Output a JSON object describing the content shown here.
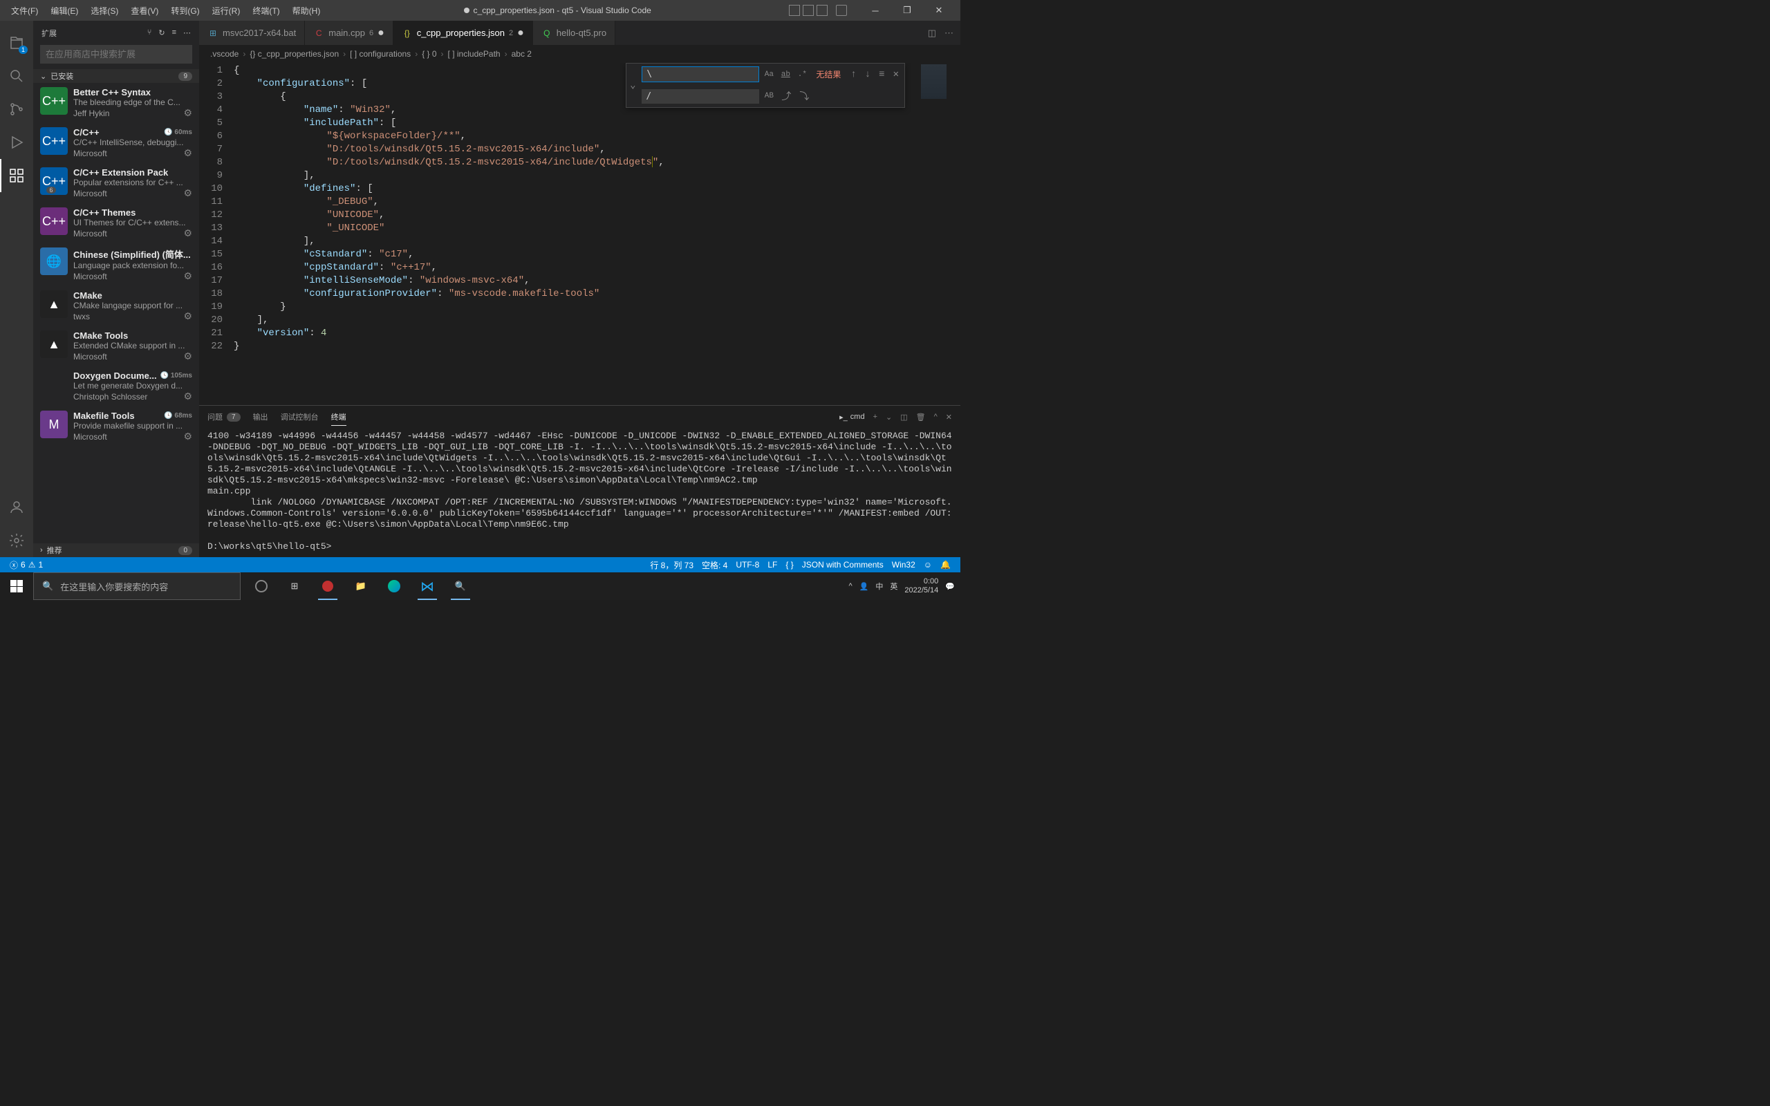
{
  "menubar": [
    "文件(F)",
    "编辑(E)",
    "选择(S)",
    "查看(V)",
    "转到(G)",
    "运行(R)",
    "终端(T)",
    "帮助(H)"
  ],
  "window_title": "c_cpp_properties.json - qt5 - Visual Studio Code",
  "sidebar": {
    "title": "扩展",
    "search_placeholder": "在应用商店中搜索扩展",
    "installed_label": "已安装",
    "installed_count": "9",
    "recommended_label": "推荐",
    "recommended_count": "0"
  },
  "extensions": [
    {
      "name": "Better C++ Syntax",
      "desc": "The bleeding edge of the C...",
      "pub": "Jeff Hykin",
      "color": "#1d7a3a",
      "icon": "C++"
    },
    {
      "name": "C/C++",
      "desc": "C/C++ IntelliSense, debuggi...",
      "pub": "Microsoft",
      "color": "#005ba4",
      "icon": "C++",
      "time": "60ms"
    },
    {
      "name": "C/C++ Extension Pack",
      "desc": "Popular extensions for C++ ...",
      "pub": "Microsoft",
      "color": "#005ba4",
      "icon": "C++",
      "badge": "6"
    },
    {
      "name": "C/C++ Themes",
      "desc": "UI Themes for C/C++ extens...",
      "pub": "Microsoft",
      "color": "#6b2d7a",
      "icon": "C++"
    },
    {
      "name": "Chinese (Simplified) (简体...",
      "desc": "Language pack extension fo...",
      "pub": "Microsoft",
      "color": "#2a6da8",
      "icon": "🌐"
    },
    {
      "name": "CMake",
      "desc": "CMake langage support for ...",
      "pub": "twxs",
      "color": "#222",
      "icon": "▲"
    },
    {
      "name": "CMake Tools",
      "desc": "Extended CMake support in ...",
      "pub": "Microsoft",
      "color": "#222",
      "icon": "▲"
    },
    {
      "name": "Doxygen Docume...",
      "desc": "Let me generate Doxygen d...",
      "pub": "Christoph Schlosser",
      "color": "",
      "icon": "",
      "time": "105ms"
    },
    {
      "name": "Makefile Tools",
      "desc": "Provide makefile support in ...",
      "pub": "Microsoft",
      "color": "#6a3a8a",
      "icon": "M",
      "time": "68ms"
    }
  ],
  "tabs": [
    {
      "label": "msvc2017-x64.bat",
      "icon_color": "#519aba",
      "icon": "⊞"
    },
    {
      "label": "main.cpp",
      "icon_color": "#cc3e44",
      "icon": "C",
      "modified": true,
      "num": "6"
    },
    {
      "label": "c_cpp_properties.json",
      "icon_color": "#cbcb41",
      "icon": "{}",
      "modified": true,
      "num": "2",
      "active": true
    },
    {
      "label": "hello-qt5.pro",
      "icon_color": "#41cd52",
      "icon": "Q"
    }
  ],
  "breadcrumb": [
    ".vscode",
    "{} c_cpp_properties.json",
    "[ ] configurations",
    "{ } 0",
    "[ ] includePath",
    "abc 2"
  ],
  "code_lines": [
    {
      "n": 1,
      "indent": 0,
      "content": [
        {
          "t": "punc",
          "v": "{"
        }
      ]
    },
    {
      "n": 2,
      "indent": 1,
      "content": [
        {
          "t": "key",
          "v": "\"configurations\""
        },
        {
          "t": "punc",
          "v": ": ["
        }
      ]
    },
    {
      "n": 3,
      "indent": 2,
      "content": [
        {
          "t": "punc",
          "v": "{"
        }
      ]
    },
    {
      "n": 4,
      "indent": 3,
      "content": [
        {
          "t": "key",
          "v": "\"name\""
        },
        {
          "t": "punc",
          "v": ": "
        },
        {
          "t": "str",
          "v": "\"Win32\""
        },
        {
          "t": "punc",
          "v": ","
        }
      ]
    },
    {
      "n": 5,
      "indent": 3,
      "content": [
        {
          "t": "key",
          "v": "\"includePath\""
        },
        {
          "t": "punc",
          "v": ": ["
        }
      ]
    },
    {
      "n": 6,
      "indent": 4,
      "content": [
        {
          "t": "str",
          "v": "\"${workspaceFolder}/**\""
        },
        {
          "t": "punc",
          "v": ","
        }
      ]
    },
    {
      "n": 7,
      "indent": 4,
      "content": [
        {
          "t": "str",
          "v": "\"D:/tools/winsdk/Qt5.15.2-msvc2015-x64/include\""
        },
        {
          "t": "punc",
          "v": ","
        }
      ]
    },
    {
      "n": 8,
      "indent": 4,
      "content": [
        {
          "t": "str",
          "v": "\"D:/tools/winsdk/Qt5.15.2-msvc2015-x64/include/QtWidgets"
        },
        {
          "t": "cursor",
          "v": ""
        },
        {
          "t": "str",
          "v": "\""
        },
        {
          "t": "punc",
          "v": ","
        }
      ]
    },
    {
      "n": 9,
      "indent": 3,
      "content": [
        {
          "t": "punc",
          "v": "],"
        }
      ]
    },
    {
      "n": 10,
      "indent": 3,
      "content": [
        {
          "t": "key",
          "v": "\"defines\""
        },
        {
          "t": "punc",
          "v": ": ["
        }
      ]
    },
    {
      "n": 11,
      "indent": 4,
      "content": [
        {
          "t": "str",
          "v": "\"_DEBUG\""
        },
        {
          "t": "punc",
          "v": ","
        }
      ]
    },
    {
      "n": 12,
      "indent": 4,
      "content": [
        {
          "t": "str",
          "v": "\"UNICODE\""
        },
        {
          "t": "punc",
          "v": ","
        }
      ]
    },
    {
      "n": 13,
      "indent": 4,
      "content": [
        {
          "t": "str",
          "v": "\"_UNICODE\""
        }
      ]
    },
    {
      "n": 14,
      "indent": 3,
      "content": [
        {
          "t": "punc",
          "v": "],"
        }
      ]
    },
    {
      "n": 15,
      "indent": 3,
      "content": [
        {
          "t": "key",
          "v": "\"cStandard\""
        },
        {
          "t": "punc",
          "v": ": "
        },
        {
          "t": "str",
          "v": "\"c17\""
        },
        {
          "t": "punc",
          "v": ","
        }
      ]
    },
    {
      "n": 16,
      "indent": 3,
      "content": [
        {
          "t": "key",
          "v": "\"cppStandard\""
        },
        {
          "t": "punc",
          "v": ": "
        },
        {
          "t": "str",
          "v": "\"c++17\""
        },
        {
          "t": "punc",
          "v": ","
        }
      ]
    },
    {
      "n": 17,
      "indent": 3,
      "content": [
        {
          "t": "key",
          "v": "\"intelliSenseMode\""
        },
        {
          "t": "punc",
          "v": ": "
        },
        {
          "t": "str",
          "v": "\"windows-msvc-x64\""
        },
        {
          "t": "punc",
          "v": ","
        }
      ]
    },
    {
      "n": 18,
      "indent": 3,
      "content": [
        {
          "t": "key",
          "v": "\"configurationProvider\""
        },
        {
          "t": "punc",
          "v": ": "
        },
        {
          "t": "str",
          "v": "\"ms-vscode.makefile-tools\""
        }
      ]
    },
    {
      "n": 19,
      "indent": 2,
      "content": [
        {
          "t": "punc",
          "v": "}"
        }
      ]
    },
    {
      "n": 20,
      "indent": 1,
      "content": [
        {
          "t": "punc",
          "v": "],"
        }
      ]
    },
    {
      "n": 21,
      "indent": 1,
      "content": [
        {
          "t": "key",
          "v": "\"version\""
        },
        {
          "t": "punc",
          "v": ": "
        },
        {
          "t": "num",
          "v": "4"
        }
      ]
    },
    {
      "n": 22,
      "indent": 0,
      "content": [
        {
          "t": "punc",
          "v": "}"
        }
      ]
    }
  ],
  "find": {
    "search_value": "\\",
    "replace_value": "/",
    "results": "无结果",
    "opts": [
      "Aa",
      "ab",
      ".*"
    ],
    "replace_opt": "AB"
  },
  "panel": {
    "tabs": [
      "问题",
      "输出",
      "调试控制台",
      "终端"
    ],
    "active_tab": 3,
    "problem_count": "7",
    "shell": "cmd"
  },
  "terminal_text": "4100 -w34189 -w44996 -w44456 -w44457 -w44458 -wd4577 -wd4467 -EHsc -DUNICODE -D_UNICODE -DWIN32 -D_ENABLE_EXTENDED_ALIGNED_STORAGE -DWIN64 -DNDEBUG -DQT_NO_DEBUG -DQT_WIDGETS_LIB -DQT_GUI_LIB -DQT_CORE_LIB -I. -I..\\..\\..\\tools\\winsdk\\Qt5.15.2-msvc2015-x64\\include -I..\\..\\..\\tools\\winsdk\\Qt5.15.2-msvc2015-x64\\include\\QtWidgets -I..\\..\\..\\tools\\winsdk\\Qt5.15.2-msvc2015-x64\\include\\QtGui -I..\\..\\..\\tools\\winsdk\\Qt5.15.2-msvc2015-x64\\include\\QtANGLE -I..\\..\\..\\tools\\winsdk\\Qt5.15.2-msvc2015-x64\\include\\QtCore -Irelease -I/include -I..\\..\\..\\tools\\winsdk\\Qt5.15.2-msvc2015-x64\\mkspecs\\win32-msvc -Forelease\\ @C:\\Users\\simon\\AppData\\Local\\Temp\\nm9AC2.tmp\nmain.cpp\n        link /NOLOGO /DYNAMICBASE /NXCOMPAT /OPT:REF /INCREMENTAL:NO /SUBSYSTEM:WINDOWS \"/MANIFESTDEPENDENCY:type='win32' name='Microsoft.Windows.Common-Controls' version='6.0.0.0' publicKeyToken='6595b64144ccf1df' language='*' processorArchitecture='*'\" /MANIFEST:embed /OUT:release\\hello-qt5.exe @C:\\Users\\simon\\AppData\\Local\\Temp\\nm9E6C.tmp\n\nD:\\works\\qt5\\hello-qt5>",
  "statusbar": {
    "errors": "6",
    "warnings": "1",
    "position": "行 8，列 73",
    "spaces": "空格: 4",
    "encoding": "UTF-8",
    "eol": "LF",
    "lang": "JSON with Comments",
    "config": "Win32"
  },
  "taskbar": {
    "search_placeholder": "在这里输入你要搜索的内容",
    "ime1": "中",
    "ime2": "英",
    "time": "0:00",
    "date": "2022/5/14"
  }
}
